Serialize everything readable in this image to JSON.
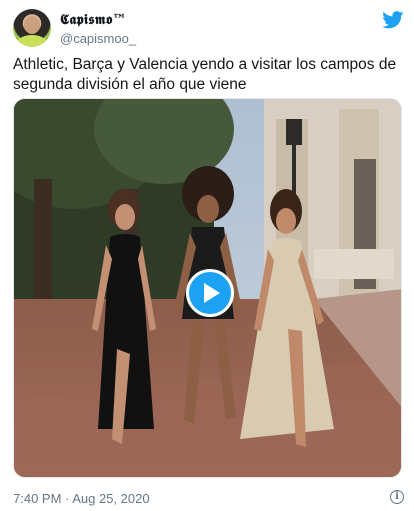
{
  "tweet": {
    "display_name": "𝕮𝖆𝖕𝖎𝖘𝖒𝖔™",
    "handle": "@capismoo_",
    "text": "Athletic, Barça y Valencia yendo a visitar los campos de segunda división el año que viene",
    "timestamp": "7:40 PM · Aug 25, 2020"
  },
  "icons": {
    "avatar": "profile-photo",
    "brand": "twitter-bird-icon",
    "play": "play-icon",
    "info": "info-icon"
  },
  "colors": {
    "brand": "#1da1f2",
    "secondary_text": "#657786",
    "primary_text": "#14171a"
  }
}
